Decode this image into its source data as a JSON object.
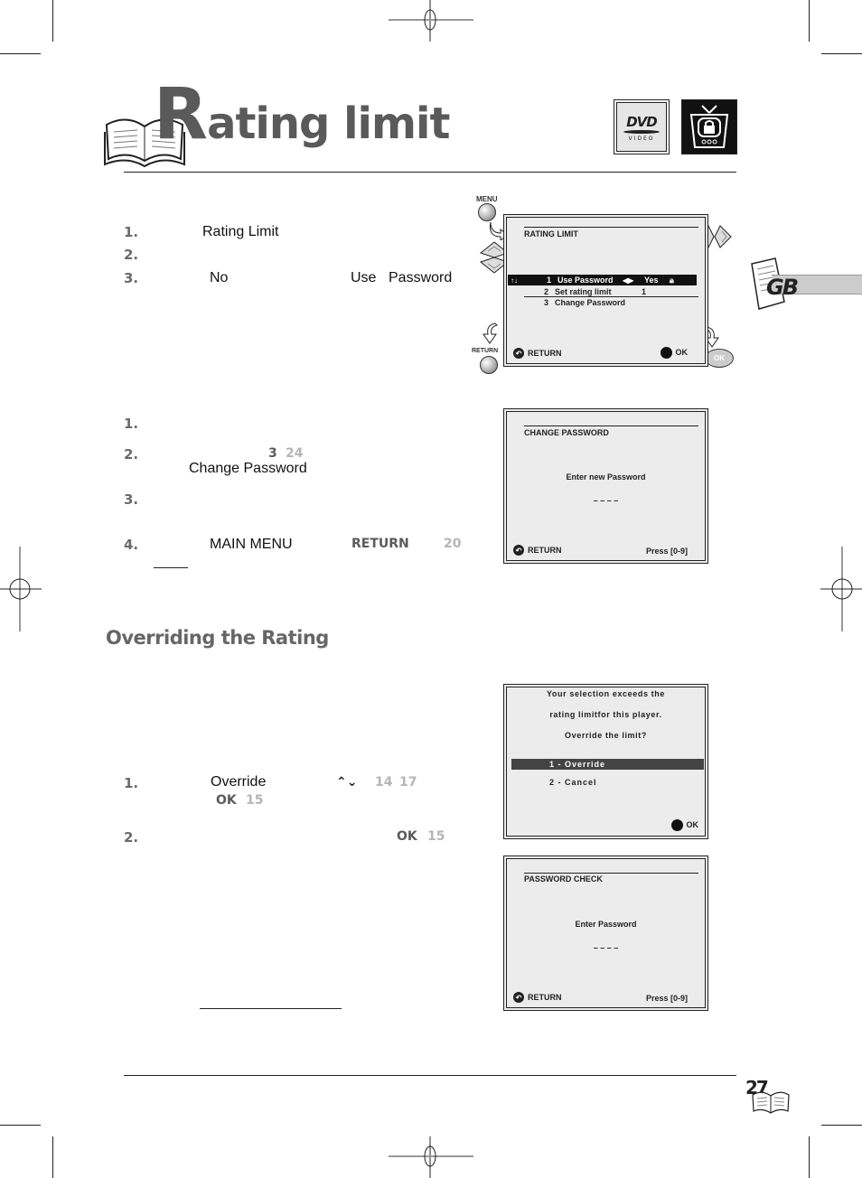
{
  "page": {
    "title_initial": "R",
    "title_rest": "ating limit",
    "language_tab": "GB",
    "page_number": "27",
    "badges": [
      "dvd-video-logo",
      "parental-lock-tv-icon"
    ],
    "dvd_logo_text": "DVD",
    "dvd_logo_subtext": "VIDEO"
  },
  "section1": {
    "steps": [
      {
        "num": "1.",
        "keyword": "Rating Limit"
      },
      {
        "num": "2.",
        "keyword": ""
      },
      {
        "num": "3.",
        "keyword": "No",
        "keyword2": "Use",
        "keyword3": "Password"
      }
    ]
  },
  "rating_limit_screen": {
    "title": "RATING LIMIT",
    "nav_icon": "up-down-arrows",
    "items": [
      {
        "num": "1",
        "label": "Use Password",
        "arrows": "◀▶",
        "value": "Yes",
        "icon": "lock",
        "selected": true
      },
      {
        "num": "2",
        "label": "Set rating limit",
        "value": "1",
        "selected": false
      },
      {
        "num": "3",
        "label": "Change Password",
        "value": "",
        "selected": false
      }
    ],
    "footer_left": "RETURN",
    "footer_right": "OK"
  },
  "remote": {
    "menu_label": "MENU",
    "return_label": "RETURN",
    "ok_label": "OK"
  },
  "section2": {
    "steps": [
      {
        "num": "1."
      },
      {
        "num": "2.",
        "btn": "3",
        "page_ref": "24",
        "keyword": "Change Password"
      },
      {
        "num": "3."
      },
      {
        "num": "4.",
        "keyword": "MAIN MENU",
        "btn": "RETURN",
        "page_ref": "20"
      }
    ]
  },
  "change_password_screen": {
    "title": "CHANGE PASSWORD",
    "prompt": "Enter new Password",
    "entry": "– – – –",
    "footer_left": "RETURN",
    "footer_right": "Press [0-9]"
  },
  "section3": {
    "heading": "Overriding the Rating",
    "steps": [
      {
        "num": "1.",
        "keyword": "Override",
        "arrows": "⌃⌄",
        "page_ref_a": "14",
        "page_ref_b": "17",
        "btn": "OK",
        "page_ref_c": "15"
      },
      {
        "num": "2.",
        "btn": "OK",
        "page_ref": "15"
      }
    ]
  },
  "override_dialog": {
    "lines": [
      "Your selection exceeds the",
      "rating limitfor this player.",
      "Override the limit?"
    ],
    "options": [
      {
        "label": "1 - Override",
        "selected": true
      },
      {
        "label": "2 - Cancel",
        "selected": false
      }
    ],
    "footer_right": "OK"
  },
  "password_check_screen": {
    "title": "PASSWORD CHECK",
    "prompt": "Enter Password",
    "entry": "– – – –",
    "footer_left": "RETURN",
    "footer_right": "Press [0-9]"
  }
}
